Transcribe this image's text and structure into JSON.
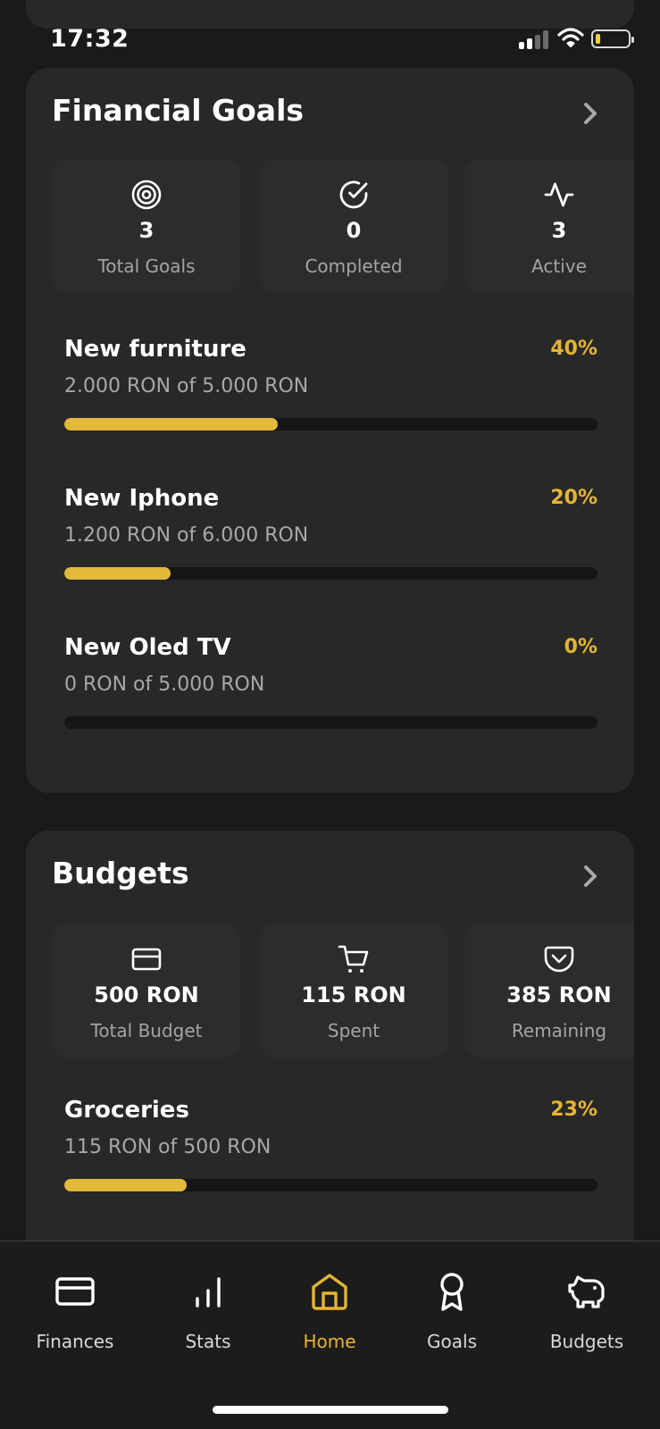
{
  "status_bar": {
    "time": "17:32",
    "signal_bars_active": 2,
    "battery_level": 0.12
  },
  "goals_card": {
    "title": "Financial Goals",
    "stats": [
      {
        "icon": "target-icon",
        "value": "3",
        "label": "Total Goals"
      },
      {
        "icon": "check-circle-icon",
        "value": "0",
        "label": "Completed"
      },
      {
        "icon": "activity-icon",
        "value": "3",
        "label": "Active"
      }
    ],
    "items": [
      {
        "name": "New furniture",
        "amount": "2.000 RON of 5.000 RON",
        "percent_label": "40%",
        "progress": 0.4
      },
      {
        "name": "New Iphone",
        "amount": "1.200 RON of 6.000 RON",
        "percent_label": "20%",
        "progress": 0.2
      },
      {
        "name": "New Oled TV",
        "amount": "0 RON of 5.000 RON",
        "percent_label": "0%",
        "progress": 0.0
      }
    ]
  },
  "budgets_card": {
    "title": "Budgets",
    "stats": [
      {
        "icon": "credit-card-icon",
        "value": "500 RON",
        "label": "Total Budget"
      },
      {
        "icon": "shopping-cart-icon",
        "value": "115 RON",
        "label": "Spent"
      },
      {
        "icon": "pocket-icon",
        "value": "385 RON",
        "label": "Remaining"
      }
    ],
    "items": [
      {
        "name": "Groceries",
        "amount": "115 RON of 500 RON",
        "percent_label": "23%",
        "progress": 0.23
      }
    ]
  },
  "bottom_nav": {
    "items": [
      {
        "label": "Finances",
        "icon": "credit-card-icon",
        "active": false
      },
      {
        "label": "Stats",
        "icon": "bar-chart-icon",
        "active": false
      },
      {
        "label": "Home",
        "icon": "home-icon",
        "active": true
      },
      {
        "label": "Goals",
        "icon": "award-icon",
        "active": false
      },
      {
        "label": "Budgets",
        "icon": "piggy-bank-icon",
        "active": false
      }
    ]
  },
  "colors": {
    "background": "#1a1a1a",
    "card": "#282828",
    "accent": "#e5b434",
    "track": "#161616",
    "muted_text": "#a4a4a4"
  }
}
